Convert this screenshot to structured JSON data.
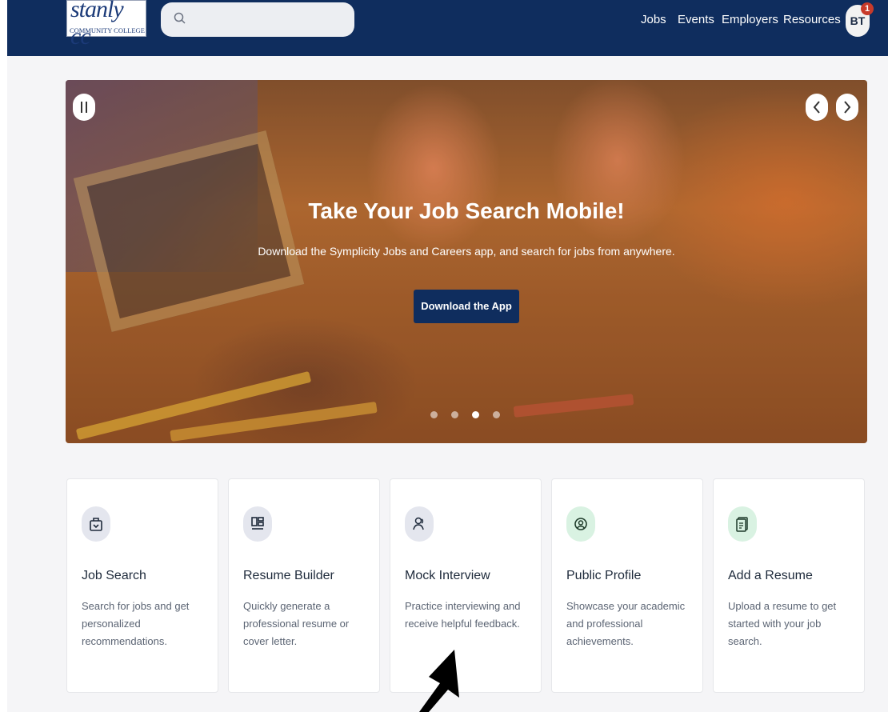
{
  "header": {
    "logo_main": "stanly cc",
    "logo_sub": "COMMUNITY COLLEGE",
    "search_placeholder": "",
    "nav": [
      "Jobs",
      "Events",
      "Employers",
      "Resources"
    ],
    "avatar_initials": "BT",
    "notification_count": "1"
  },
  "hero": {
    "title": "Take Your Job Search Mobile!",
    "subtitle": "Download the Symplicity Jobs and Careers app, and search for jobs from anywhere.",
    "button_label": "Download the App",
    "active_slide": 3,
    "slide_count": 4
  },
  "cards": [
    {
      "title": "Job Search",
      "description": "Search for jobs and get personalized recommendations.",
      "icon": "briefcase-icon"
    },
    {
      "title": "Resume Builder",
      "description": "Quickly generate a professional resume or cover letter.",
      "icon": "layout-icon"
    },
    {
      "title": "Mock Interview",
      "description": "Practice interviewing and receive helpful feedback.",
      "icon": "interview-icon"
    },
    {
      "title": "Public Profile",
      "description": "Showcase your academic and professional achievements.",
      "icon": "profile-icon"
    },
    {
      "title": "Add a Resume",
      "description": "Upload a resume to get started with your job search.",
      "icon": "document-icon"
    }
  ],
  "colors": {
    "header_bg": "#0f2d5e",
    "card_icon_gray": "#e4e6ee",
    "card_icon_green": "#d9f2e2",
    "badge": "#c83a2a"
  }
}
